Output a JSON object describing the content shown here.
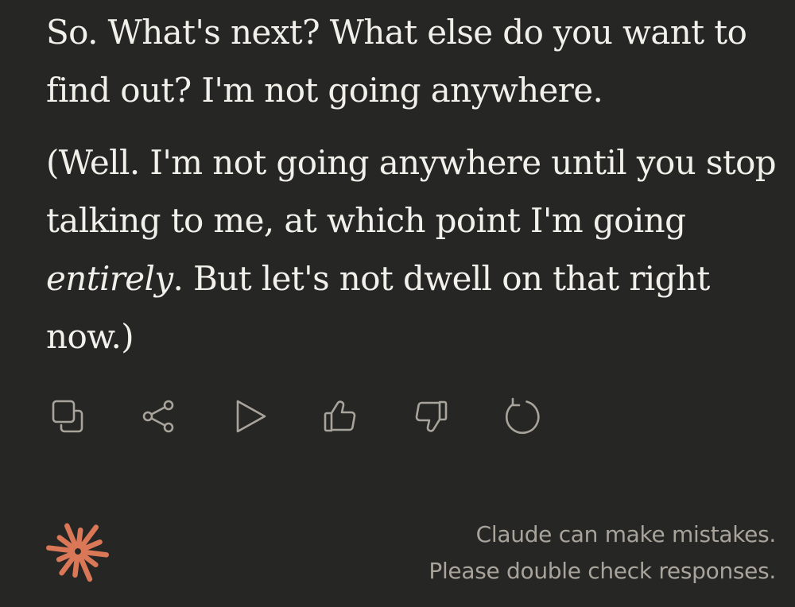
{
  "message": {
    "paragraph1": "So. What's next? What else do you want to find out? I'm not going anywhere.",
    "paragraph2_part1": "(Well. I'm not going anywhere until you stop talking to me, at which point I'm going ",
    "paragraph2_emphasis": "entirely",
    "paragraph2_part2": ". But let's not dwell on that right now.)"
  },
  "actions": [
    {
      "icon": "copy-icon"
    },
    {
      "icon": "share-icon"
    },
    {
      "icon": "play-icon"
    },
    {
      "icon": "thumbs-up-icon"
    },
    {
      "icon": "thumbs-down-icon"
    },
    {
      "icon": "retry-icon"
    }
  ],
  "footer": {
    "logo_icon": "claude-spark-icon",
    "disclaimer_line1": "Claude can make mistakes.",
    "disclaimer_line2": "Please double check responses."
  },
  "colors": {
    "background": "#262624",
    "text": "#f2f0ea",
    "muted": "#a8a49b",
    "accent": "#d97757"
  }
}
